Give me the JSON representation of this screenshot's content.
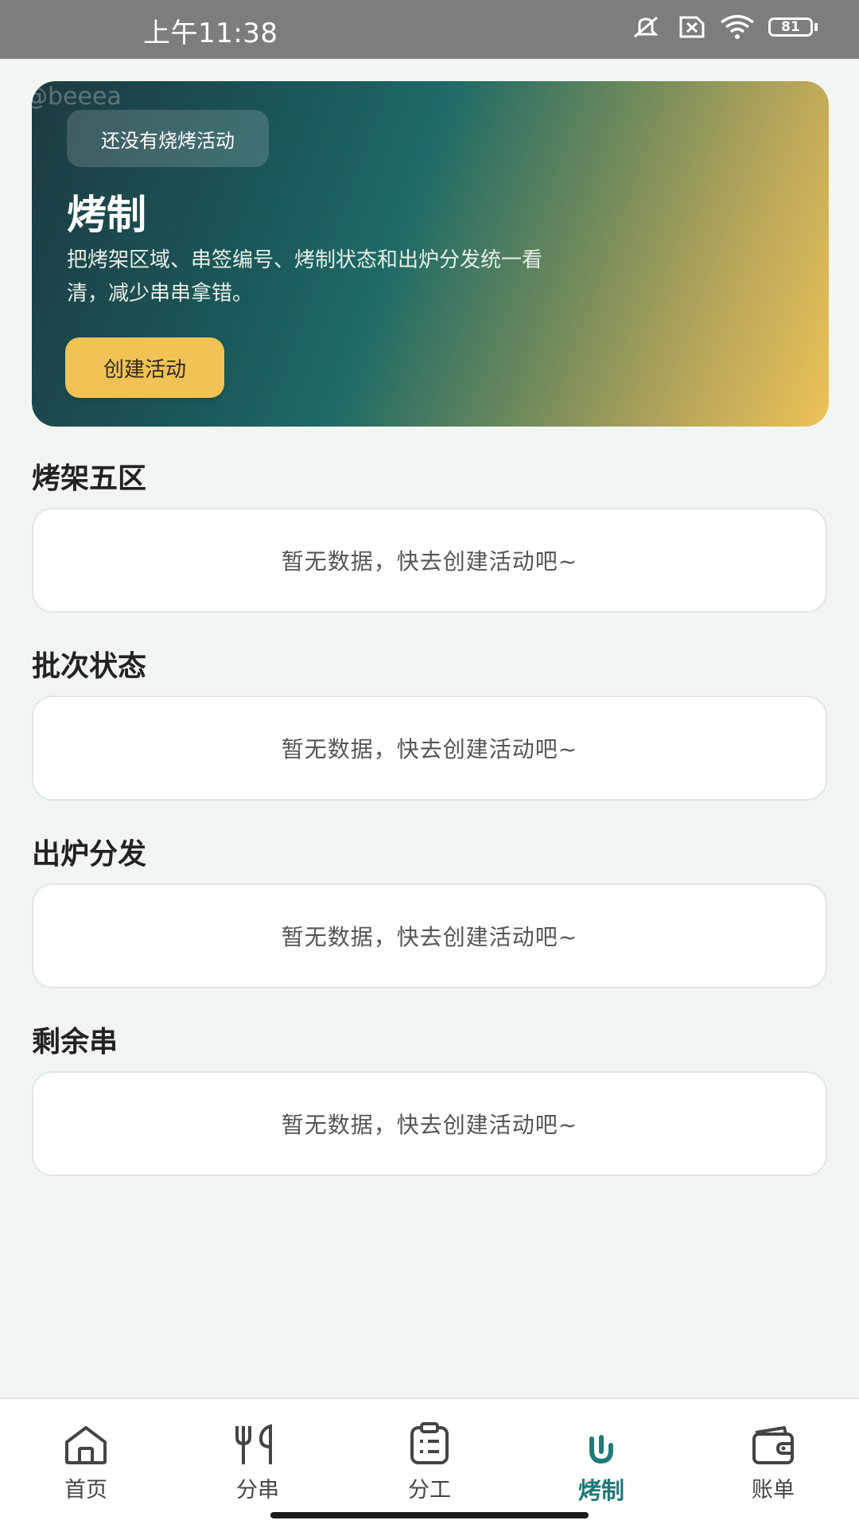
{
  "status_bar": {
    "time": "上午11:38",
    "battery": "81"
  },
  "hero": {
    "watermark": "@beeea",
    "badge": "还没有烧烤活动",
    "title": "烤制",
    "description": "把烤架区域、串签编号、烤制状态和出炉分发统一看清，减少串串拿错。",
    "button": "创建活动"
  },
  "sections": [
    {
      "title": "烤架五区",
      "empty_text": "暂无数据，快去创建活动吧~"
    },
    {
      "title": "批次状态",
      "empty_text": "暂无数据，快去创建活动吧~"
    },
    {
      "title": "出炉分发",
      "empty_text": "暂无数据，快去创建活动吧~"
    },
    {
      "title": "剩余串",
      "empty_text": "暂无数据，快去创建活动吧~"
    }
  ],
  "bottom_nav": {
    "items": [
      {
        "label": "首页",
        "icon": "home-icon"
      },
      {
        "label": "分串",
        "icon": "skewer-icon"
      },
      {
        "label": "分工",
        "icon": "clipboard-icon"
      },
      {
        "label": "烤制",
        "icon": "grill-icon"
      },
      {
        "label": "账单",
        "icon": "wallet-icon"
      }
    ],
    "active": "烤制"
  },
  "colors": {
    "accent": "#1f7a78",
    "button": "#f1c254",
    "background": "#f1f6f3"
  }
}
